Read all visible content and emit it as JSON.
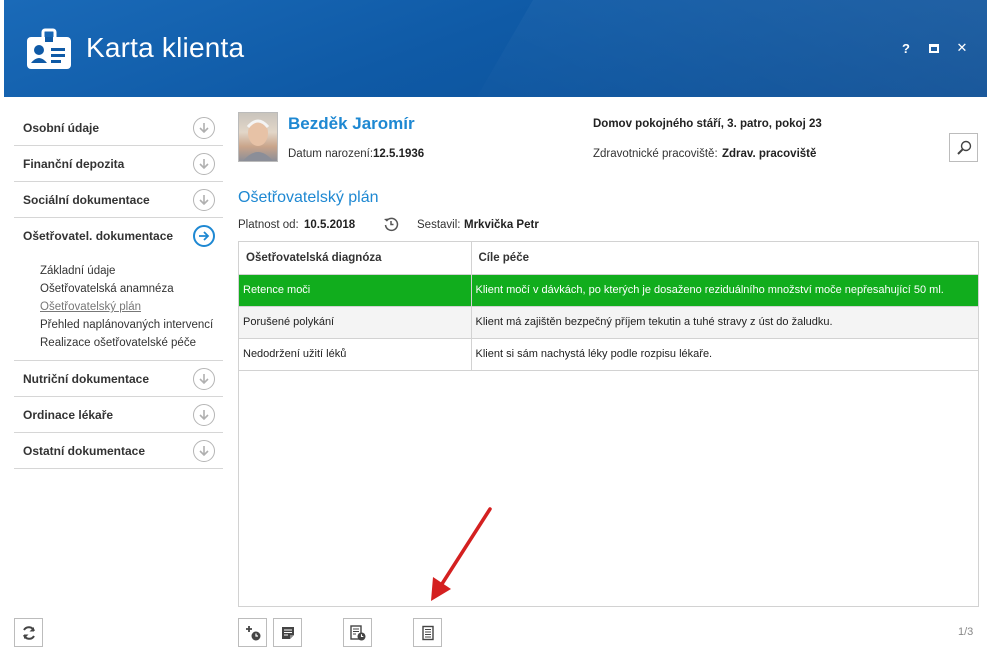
{
  "window": {
    "title": "Karta klienta",
    "help_label": "?",
    "close_label": "✕"
  },
  "sidebar": {
    "sections": [
      {
        "label": "Osobní údaje"
      },
      {
        "label": "Finanční depozita"
      },
      {
        "label": "Sociální dokumentace"
      },
      {
        "label": "Ošetřovatel. dokumentace",
        "active": true
      },
      {
        "label": "Nutriční dokumentace"
      },
      {
        "label": "Ordinace lékaře"
      },
      {
        "label": "Ostatní dokumentace"
      }
    ],
    "subitems": [
      {
        "label": "Základní údaje"
      },
      {
        "label": "Ošetřovatelská anamnéza"
      },
      {
        "label": "Ošetřovatelský plán",
        "current": true
      },
      {
        "label": "Přehled naplánovaných intervencí"
      },
      {
        "label": "Realizace ošetřovatelské péče"
      }
    ]
  },
  "client": {
    "name": "Bezděk Jaromír",
    "dob_label": "Datum narození:",
    "dob": "12.5.1936",
    "facility": "Domov pokojného stáří, 3. patro, pokoj 23",
    "workplace_label": "Zdravotnické pracoviště:",
    "workplace": "Zdrav. pracoviště"
  },
  "plan": {
    "title": "Ošetřovatelský plán",
    "valid_label": "Platnost od:",
    "valid_from": "10.5.2018",
    "author_label": "Sestavil:",
    "author": "Mrkvička Petr"
  },
  "table": {
    "columns": [
      "Ošetřovatelská diagnóza",
      "Cíle péče"
    ],
    "rows": [
      {
        "diagnosis": "Retence moči",
        "goal": "Klient močí v dávkách, po kterých je dosaženo reziduálního množství moče nepřesahující 50 ml."
      },
      {
        "diagnosis": "Porušené polykání",
        "goal": "Klient má zajištěn bezpečný příjem tekutin a tuhé stravy z úst do žaludku."
      },
      {
        "diagnosis": "Nedodržení užití léků",
        "goal": "Klient si sám nachystá léky podle rozpisu lékaře."
      }
    ],
    "selected_row": 0
  },
  "footer": {
    "pager": "1/3"
  },
  "icons": [
    "id-card-icon",
    "search-icon",
    "history-icon",
    "refresh-icon",
    "add-schedule-icon",
    "edit-document-icon",
    "document-schedule-icon",
    "document-icon",
    "arrow-down-icon",
    "arrow-right-icon"
  ],
  "colors": {
    "header": "#0f5aa6",
    "accent": "#1e88d2",
    "selected_row": "#11ad1d",
    "annotation_arrow": "#d42020"
  }
}
